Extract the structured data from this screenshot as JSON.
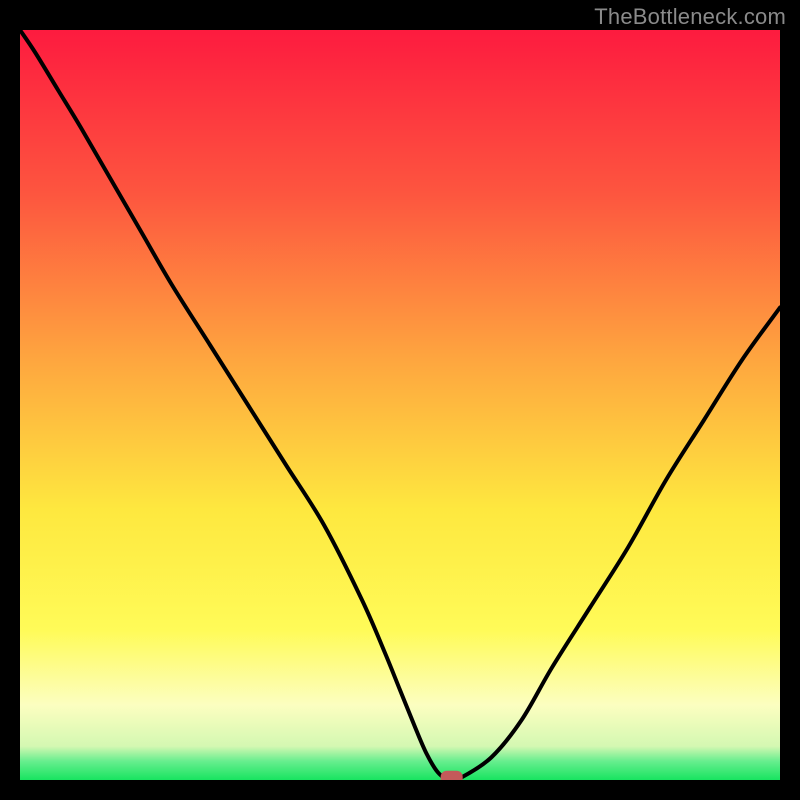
{
  "watermark": "TheBottleneck.com",
  "chart_data": {
    "type": "line",
    "title": "",
    "xlabel": "",
    "ylabel": "",
    "xlim": [
      0,
      100
    ],
    "ylim": [
      0,
      100
    ],
    "grid": false,
    "legend": false,
    "x": [
      0,
      2,
      5,
      8,
      12,
      16,
      20,
      25,
      30,
      35,
      40,
      45,
      48,
      50,
      52,
      53.5,
      55,
      56.5,
      58,
      62,
      66,
      70,
      75,
      80,
      85,
      90,
      95,
      100
    ],
    "y": [
      100,
      97,
      92,
      87,
      80,
      73,
      66,
      58,
      50,
      42,
      34,
      24,
      17,
      12,
      7,
      3.5,
      1,
      0,
      0.3,
      3,
      8,
      15,
      23,
      31,
      40,
      48,
      56,
      63
    ],
    "marker": {
      "x": 56.8,
      "y": 0.3,
      "color": "#c45a5a"
    }
  },
  "colors": {
    "gradient_top": "#fd1b3f",
    "gradient_mid1": "#fd6d3f",
    "gradient_mid2": "#fec23f",
    "gradient_yellow": "#fff93f",
    "gradient_pale": "#fdfec1",
    "gradient_green": "#1ae562",
    "curve": "#000000",
    "marker": "#c45a5a",
    "frame": "#000000"
  }
}
